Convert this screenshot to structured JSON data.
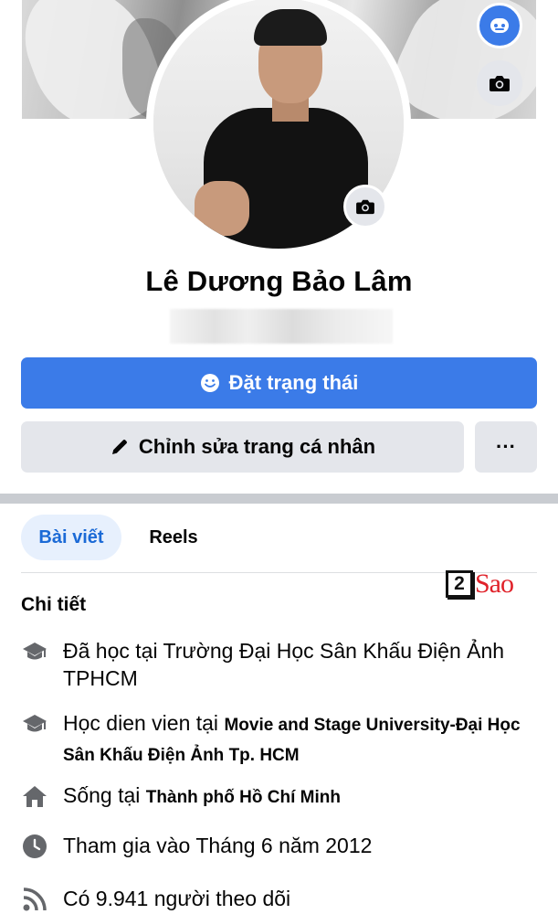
{
  "profile": {
    "name": "Lê Dương Bảo Lâm"
  },
  "actions": {
    "primary_label": "Đặt trạng thái",
    "edit_label": "Chỉnh sửa trang cá nhân",
    "more_label": "···"
  },
  "tabs": [
    {
      "label": "Bài viết",
      "active": true
    },
    {
      "label": "Reels",
      "active": false
    }
  ],
  "watermark": {
    "number": "2",
    "text": "Sao"
  },
  "details": {
    "title": "Chi tiết",
    "items": [
      {
        "icon": "graduation-cap-icon",
        "prefix": "Đã học tại Trường Đại Học Sân Khấu Điện Ảnh TPHCM",
        "bold": ""
      },
      {
        "icon": "graduation-cap-icon",
        "prefix": "Học dien vien tại ",
        "bold": "Movie and Stage University-Đại Học Sân Khấu Điện Ảnh Tp. HCM"
      },
      {
        "icon": "home-icon",
        "prefix": "Sống tại ",
        "bold": "Thành phố Hồ Chí Minh"
      },
      {
        "icon": "clock-icon",
        "prefix": "Tham gia vào Tháng 6 năm 2012",
        "bold": ""
      },
      {
        "icon": "rss-icon",
        "prefix": "Có 9.941 người theo dõi",
        "bold": ""
      }
    ]
  },
  "colors": {
    "accent": "#3b7be8",
    "tab_active_bg": "#e7f0fd",
    "tab_active_text": "#1b6ad6",
    "secondary_bg": "#e4e6eb",
    "watermark_red": "#e0222a"
  }
}
